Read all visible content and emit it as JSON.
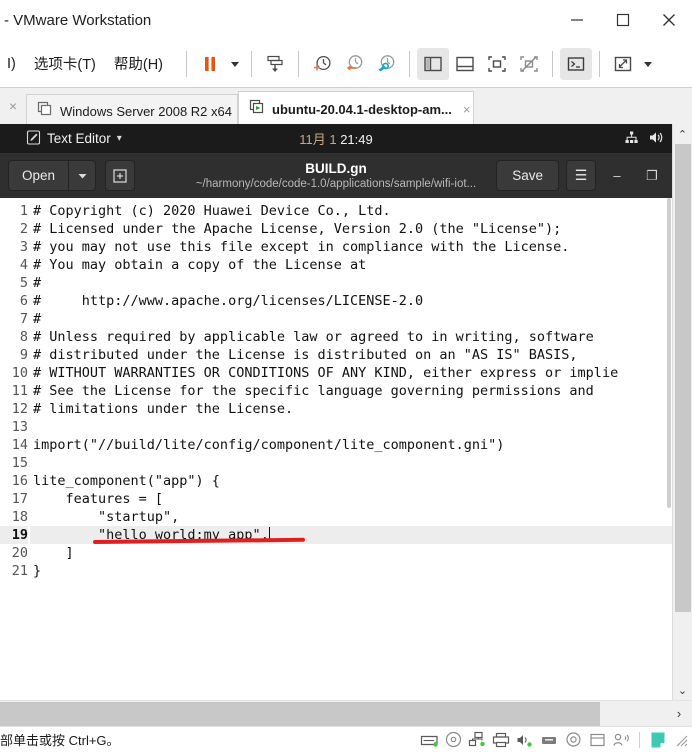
{
  "window": {
    "title": "VMware Workstation",
    "title_prefix_clipped": "-",
    "minimize_label": "Minimize",
    "maximize_label": "Maximize",
    "close_label": "Close"
  },
  "menubar": {
    "items": [
      {
        "label": "I)",
        "clipped": true
      },
      {
        "label": "选项卡(T)",
        "mnemonic": "T"
      },
      {
        "label": "帮助(H)",
        "mnemonic": "H"
      }
    ],
    "toolbar": [
      {
        "name": "pause-vm-icon",
        "tip": "Pause"
      },
      {
        "name": "pause-dropdown-caret-icon",
        "tip": "Power options"
      },
      {
        "name": "send-ctrl-alt-del-icon",
        "tip": "Send Ctrl+Alt+Del"
      },
      {
        "name": "snapshot-take-icon",
        "tip": "Take snapshot"
      },
      {
        "name": "snapshot-revert-icon",
        "tip": "Revert to snapshot"
      },
      {
        "name": "snapshot-manager-icon",
        "tip": "Manage snapshots"
      },
      {
        "name": "sidebar-toggle-icon",
        "tip": "Show or hide library"
      },
      {
        "name": "thumbnail-bar-icon",
        "tip": "Show or hide thumbnail bar"
      },
      {
        "name": "fullscreen-icon",
        "tip": "Enter full screen"
      },
      {
        "name": "unity-mode-icon",
        "tip": "Unity mode"
      },
      {
        "name": "console-view-icon",
        "tip": "Console view"
      },
      {
        "name": "stretch-guest-icon",
        "tip": "Stretch guest"
      },
      {
        "name": "stretch-dropdown-caret-icon",
        "tip": "Display options"
      }
    ],
    "active_toolbar_buttons": [
      "sidebar-toggle-icon",
      "console-view-icon"
    ],
    "accent_color": "#e8550e"
  },
  "tabs": {
    "close_all_label": "×",
    "items": [
      {
        "label": "Windows Server 2008 R2 x64",
        "active": false,
        "icon": "vm-window-icon",
        "close_label": "×"
      },
      {
        "label": "ubuntu-20.04.1-desktop-am...",
        "active": true,
        "icon": "vm-running-icon",
        "close_label": "×"
      }
    ]
  },
  "guest": {
    "gnome_topbar": {
      "app_icon": "gedit-icon",
      "app_name": "Text Editor",
      "app_menu_caret": "▾",
      "clock_date": "11月 1",
      "clock_time": "21:49",
      "tray": [
        {
          "name": "network-wired-icon"
        },
        {
          "name": "volume-icon"
        }
      ]
    },
    "gedit": {
      "open_label": "Open",
      "open_caret": "▾",
      "new_tab_label": "⊞",
      "filename": "BUILD.gn",
      "filepath": "~/harmony/code/code-1.0/applications/sample/wifi-iot...",
      "save_label": "Save",
      "menu_label": "☰",
      "minimize_label": "–",
      "restore_label": "❐",
      "current_line": 19,
      "caret_line": 19,
      "lines": [
        {
          "n": 1,
          "text": "# Copyright (c) 2020 Huawei Device Co., Ltd."
        },
        {
          "n": 2,
          "text": "# Licensed under the Apache License, Version 2.0 (the \"License\");"
        },
        {
          "n": 3,
          "text": "# you may not use this file except in compliance with the License."
        },
        {
          "n": 4,
          "text": "# You may obtain a copy of the License at"
        },
        {
          "n": 5,
          "text": "#"
        },
        {
          "n": 6,
          "text": "#     http://www.apache.org/licenses/LICENSE-2.0"
        },
        {
          "n": 7,
          "text": "#"
        },
        {
          "n": 8,
          "text": "# Unless required by applicable law or agreed to in writing, software"
        },
        {
          "n": 9,
          "text": "# distributed under the License is distributed on an \"AS IS\" BASIS,"
        },
        {
          "n": 10,
          "text": "# WITHOUT WARRANTIES OR CONDITIONS OF ANY KIND, either express or implie"
        },
        {
          "n": 11,
          "text": "# See the License for the specific language governing permissions and"
        },
        {
          "n": 12,
          "text": "# limitations under the License."
        },
        {
          "n": 13,
          "text": ""
        },
        {
          "n": 14,
          "text": "import(\"//build/lite/config/component/lite_component.gni\")"
        },
        {
          "n": 15,
          "text": ""
        },
        {
          "n": 16,
          "text": "lite_component(\"app\") {"
        },
        {
          "n": 17,
          "text": "    features = ["
        },
        {
          "n": 18,
          "text": "        \"startup\","
        },
        {
          "n": 19,
          "text": "        \"hello_world:my_app\","
        },
        {
          "n": 20,
          "text": "    ]"
        },
        {
          "n": 21,
          "text": "}"
        }
      ],
      "annotation": {
        "name": "red-underline-annotation",
        "color": "#e02020",
        "target_line": 19
      }
    }
  },
  "scrollbars": {
    "vertical_up": "⌃",
    "vertical_down": "⌄",
    "horizontal_right": "›"
  },
  "statusbar": {
    "message": "部单击或按 Ctrl+G。",
    "devices": [
      {
        "name": "hard-disk-icon"
      },
      {
        "name": "cd-dvd-icon"
      },
      {
        "name": "network-adapter-icon"
      },
      {
        "name": "printer-icon"
      },
      {
        "name": "sound-card-icon"
      },
      {
        "name": "usb-controller-icon"
      },
      {
        "name": "camera-icon"
      },
      {
        "name": "display-icon"
      },
      {
        "name": "bluetooth-icon"
      }
    ],
    "indicator": {
      "name": "guest-connected-indicator",
      "color": "#3ec9b5"
    },
    "grip": {
      "name": "resize-grip-icon"
    }
  }
}
